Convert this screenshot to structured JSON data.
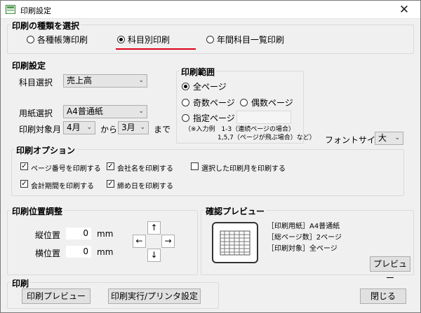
{
  "window": {
    "title": "印刷設定",
    "close_glyph": "✕"
  },
  "print_type": {
    "title": "印刷の種類を選択",
    "options": [
      "各種帳簿印刷",
      "科目別印刷",
      "年間科目一覧印刷"
    ],
    "selected": "科目別印刷"
  },
  "print_settings": {
    "title": "印刷設定",
    "account_label": "科目選択",
    "account_value": "売上高",
    "paper_label": "用紙選択",
    "paper_value": "A4普通紙",
    "month_label": "印刷対象月",
    "month_from": "4月",
    "from_text": "から",
    "month_to": "3月",
    "to_text": "まで"
  },
  "print_range": {
    "title": "印刷範囲",
    "all_pages": "全ページ",
    "odd_pages": "奇数ページ",
    "even_pages": "偶数ページ",
    "specified_pages": "指定ページ",
    "specified_value": "",
    "note_line1": "（※入力例　1-3（連続ページの場合）",
    "note_line2": "1,5,7（ページが飛ぶ場合）など）",
    "selected": "全ページ"
  },
  "font_size": {
    "label": "フォントサイズ",
    "value": "大"
  },
  "print_options": {
    "title": "印刷オプション",
    "page_number": "ページ番号を印刷する",
    "company_name": "会社名を印刷する",
    "selected_month": "選択した印刷月を印刷する",
    "fiscal_period": "会計期間を印刷する",
    "closing_date": "締め日を印刷する",
    "checked": {
      "page_number": true,
      "company_name": true,
      "selected_month": false,
      "fiscal_period": true,
      "closing_date": true
    }
  },
  "position": {
    "title": "印刷位置調整",
    "vertical_label": "縦位置",
    "vertical_value": "0",
    "horizontal_label": "横位置",
    "horizontal_value": "0",
    "unit": "mm",
    "up": "↑",
    "down": "↓",
    "left": "←",
    "right": "→"
  },
  "preview": {
    "title": "確認プレビュー",
    "paper_line": "［印刷用紙］A4普通紙",
    "total_pages_line": "［総ページ数］2ページ",
    "target_line": "［印刷対象］全ページ",
    "button": "プレビュー"
  },
  "print": {
    "title": "印刷",
    "preview_button": "印刷プレビュー",
    "execute_button": "印刷実行/プリンタ設定"
  },
  "close_button": "閉じる"
}
